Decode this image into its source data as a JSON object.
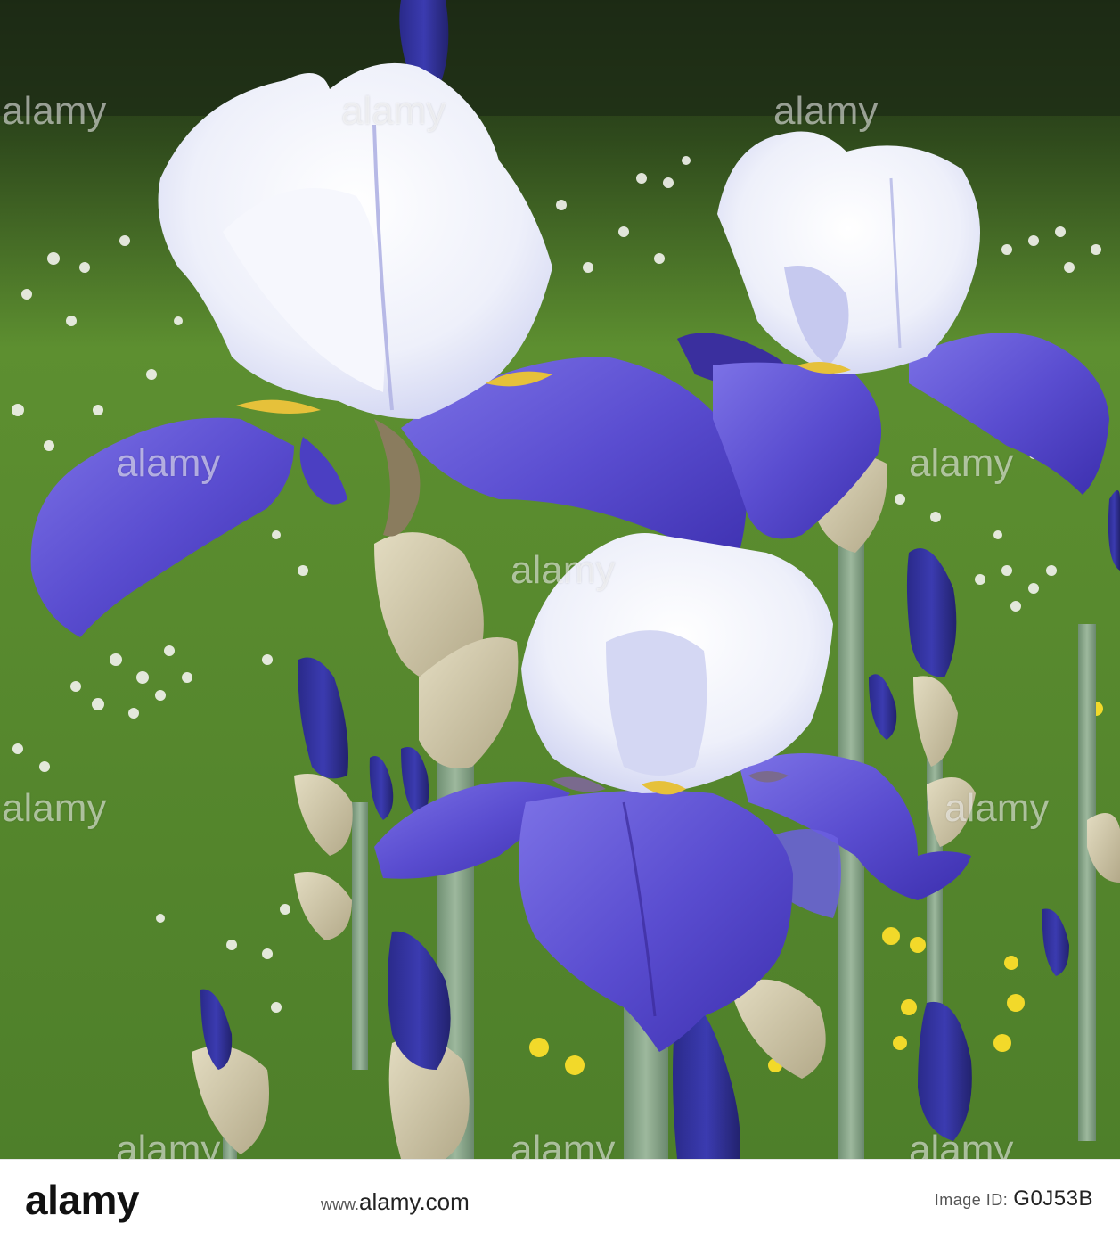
{
  "image": {
    "subject": "bearded-iris-flowers",
    "watermark_text": "alamy"
  },
  "footer": {
    "logo": "alamy",
    "url_prefix": "www.",
    "url_main": "alamy.com",
    "image_id_label": "Image ID:",
    "image_id": "G0J53B"
  },
  "colors": {
    "grass": "#5a8f2e",
    "petal_white": "#eef0fb",
    "petal_blue": "#5a4fd0",
    "stem": "#8aa88a",
    "dark_bg": "#1a2a14"
  }
}
